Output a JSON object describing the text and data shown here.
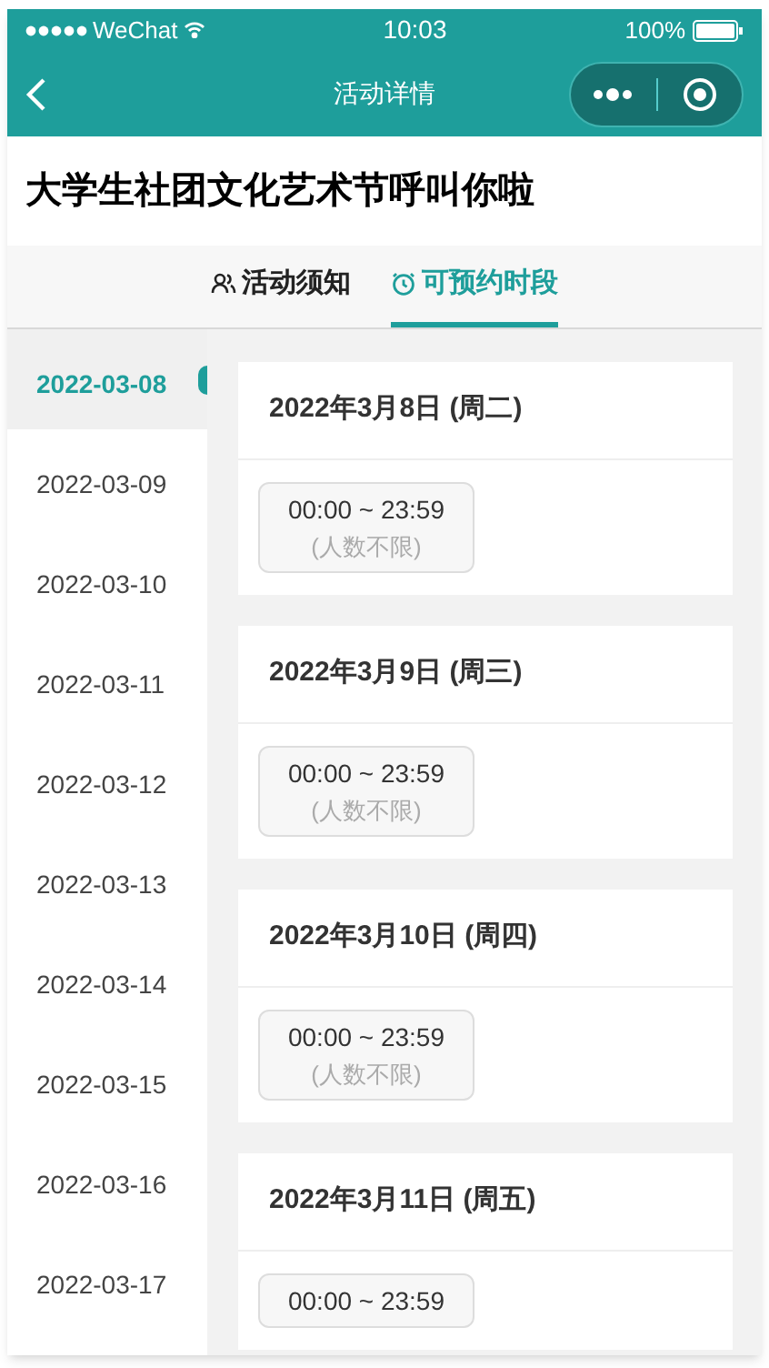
{
  "status_bar": {
    "carrier": "WeChat",
    "time": "10:03",
    "battery": "100%"
  },
  "nav": {
    "title": "活动详情"
  },
  "page_title": "大学生社团文化艺术节呼叫你啦",
  "tabs": [
    {
      "label": "活动须知",
      "kind": "notice",
      "selected": false
    },
    {
      "label": "可预约时段",
      "kind": "time",
      "selected": true
    }
  ],
  "dates": [
    {
      "label": "2022-03-08",
      "selected": true
    },
    {
      "label": "2022-03-09",
      "selected": false
    },
    {
      "label": "2022-03-10",
      "selected": false
    },
    {
      "label": "2022-03-11",
      "selected": false
    },
    {
      "label": "2022-03-12",
      "selected": false
    },
    {
      "label": "2022-03-13",
      "selected": false
    },
    {
      "label": "2022-03-14",
      "selected": false
    },
    {
      "label": "2022-03-15",
      "selected": false
    },
    {
      "label": "2022-03-16",
      "selected": false
    },
    {
      "label": "2022-03-17",
      "selected": false
    }
  ],
  "days": [
    {
      "title": "2022年3月8日 (周二)",
      "slots": [
        {
          "time": "00:00 ~ 23:59",
          "capacity": "(人数不限)"
        }
      ]
    },
    {
      "title": "2022年3月9日 (周三)",
      "slots": [
        {
          "time": "00:00 ~ 23:59",
          "capacity": "(人数不限)"
        }
      ]
    },
    {
      "title": "2022年3月10日 (周四)",
      "slots": [
        {
          "time": "00:00 ~ 23:59",
          "capacity": "(人数不限)"
        }
      ]
    },
    {
      "title": "2022年3月11日 (周五)",
      "slots": [
        {
          "time": "00:00 ~ 23:59"
        }
      ]
    }
  ]
}
